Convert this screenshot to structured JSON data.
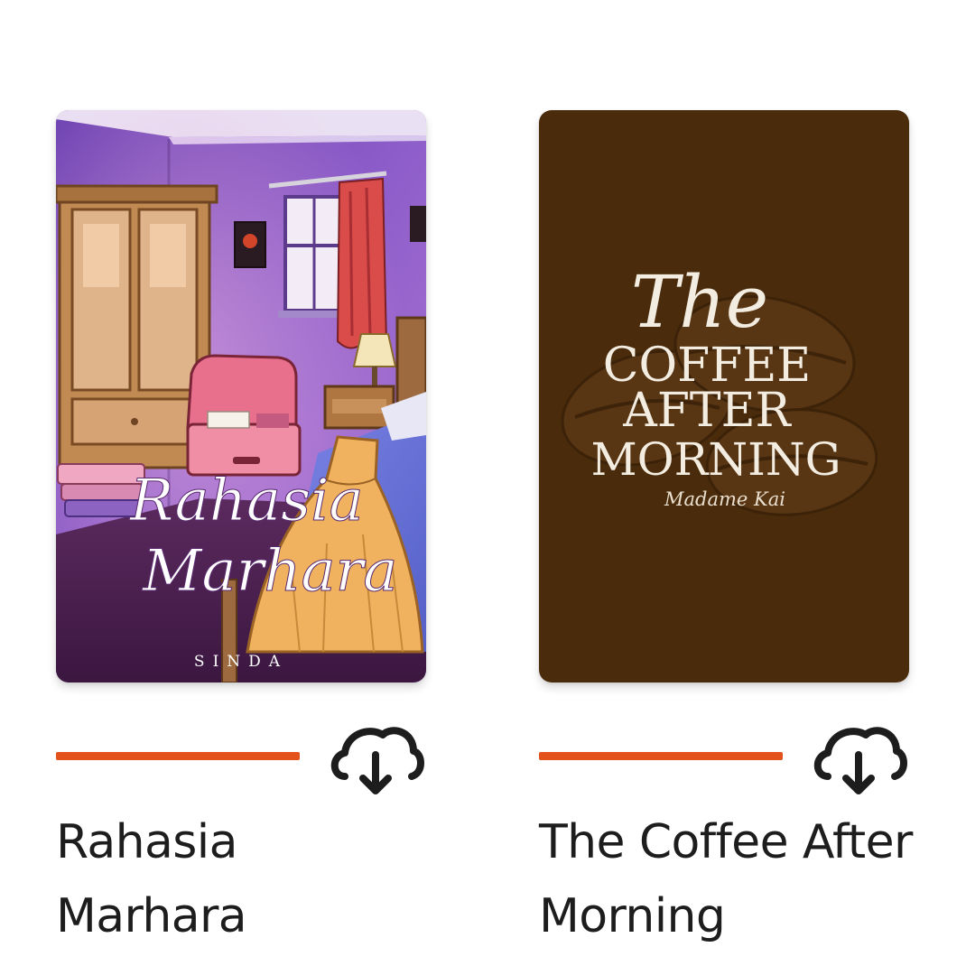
{
  "books": [
    {
      "title": "Rahasia Marhara",
      "cover": {
        "title_line_1": "Rahasia",
        "title_line_2": "Marhara",
        "author": "SINDA"
      },
      "progress": 1.0,
      "download_icon": "cloud-download-icon"
    },
    {
      "title": "The Coffee After Morning",
      "cover": {
        "title_line_1": "The",
        "title_line_2": "COFFEE",
        "title_line_3": "AFTER",
        "title_line_4": "MORNING",
        "author": "Madame Kai"
      },
      "progress": 1.0,
      "download_icon": "cloud-download-icon"
    }
  ],
  "colors": {
    "progress": "#e4521b",
    "title_text": "#1d1d1d",
    "coffee_cover_bg": "#4a2c0c",
    "coffee_cover_text": "#f3ece0"
  }
}
